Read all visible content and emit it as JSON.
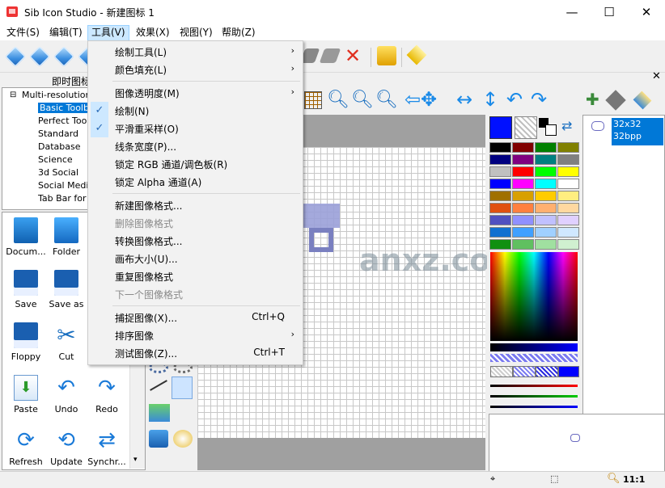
{
  "window": {
    "title": "Sib Icon Studio - 新建图标 1",
    "minimize": "—",
    "maximize": "☐",
    "close": "✕"
  },
  "menubar": [
    "文件(S)",
    "编辑(T)",
    "工具(V)",
    "效果(X)",
    "视图(Y)",
    "帮助(Z)"
  ],
  "left_panel": {
    "header": "即时图标",
    "tree_root": "Multi-resolution ic",
    "tree_items": [
      "Basic Toolbar",
      "Perfect Toolb",
      "Standard",
      "Database",
      "Science",
      "3d Social",
      "Social Media",
      "Tab Bar for iP"
    ],
    "library": [
      {
        "label": "Docum...",
        "icon": "document-icon"
      },
      {
        "label": "Folder",
        "icon": "folder-icon"
      },
      {
        "label": "Save",
        "icon": "floppy-icon"
      },
      {
        "label": "Save as",
        "icon": "save-as-icon"
      },
      {
        "label": "Floppy",
        "icon": "floppy-icon"
      },
      {
        "label": "Cut",
        "icon": "scissors-icon"
      },
      {
        "label": "Paste",
        "icon": "paste-icon"
      },
      {
        "label": "Undo",
        "icon": "undo-icon"
      },
      {
        "label": "Redo",
        "icon": "redo-icon"
      },
      {
        "label": "Refresh",
        "icon": "refresh-icon"
      },
      {
        "label": "Update",
        "icon": "update-icon"
      },
      {
        "label": "Synchr..."
      }
    ]
  },
  "dropdown": [
    {
      "label": "绘制工具(L)",
      "submenu": true
    },
    {
      "label": "颜色填充(L)",
      "submenu": true
    },
    {
      "sep": true
    },
    {
      "label": "图像透明度(M)",
      "submenu": true
    },
    {
      "label": "绘制(N)",
      "checked": true
    },
    {
      "label": "平滑重采样(O)",
      "checked": true
    },
    {
      "label": "线条宽度(P)..."
    },
    {
      "label": "锁定 RGB 通道/调色板(R)"
    },
    {
      "label": "锁定 Alpha 通道(A)"
    },
    {
      "sep": true
    },
    {
      "label": "新建图像格式..."
    },
    {
      "label": "删除图像格式",
      "disabled": true
    },
    {
      "label": "转换图像格式..."
    },
    {
      "label": "画布大小(U)..."
    },
    {
      "label": "重复图像格式"
    },
    {
      "label": "下一个图像格式",
      "disabled": true
    },
    {
      "sep": true
    },
    {
      "label": "捕捉图像(X)...",
      "shortcut": "Ctrl+Q"
    },
    {
      "label": "排序图像",
      "submenu": true
    },
    {
      "label": "测试图像(Z)...",
      "shortcut": "Ctrl+T"
    }
  ],
  "formats": {
    "line1": "32x32",
    "line2": "32bpp"
  },
  "status": {
    "zoom": "11:1"
  },
  "watermark": "anxz.com",
  "palette_colors": [
    [
      "#000000",
      "#800000",
      "#008000",
      "#808000"
    ],
    [
      "#000080",
      "#800080",
      "#008080",
      "#808080"
    ],
    [
      "#c0c0c0",
      "#ff0000",
      "#00ff00",
      "#ffff00"
    ],
    [
      "#0000ff",
      "#ff00ff",
      "#00ffff",
      "#ffffff"
    ],
    [
      "#a07000",
      "#d8a000",
      "#ffcc00",
      "#ffee80"
    ],
    [
      "#e05010",
      "#ff8040",
      "#ffb070",
      "#ffd8a0"
    ],
    [
      "#5050c0",
      "#9090ff",
      "#c0c0ff",
      "#e0d0ff"
    ],
    [
      "#1070d0",
      "#40a0ff",
      "#a0d0ff",
      "#d0e8ff"
    ],
    [
      "#109010",
      "#60c060",
      "#a0e0a0",
      "#d0f0d0"
    ]
  ]
}
